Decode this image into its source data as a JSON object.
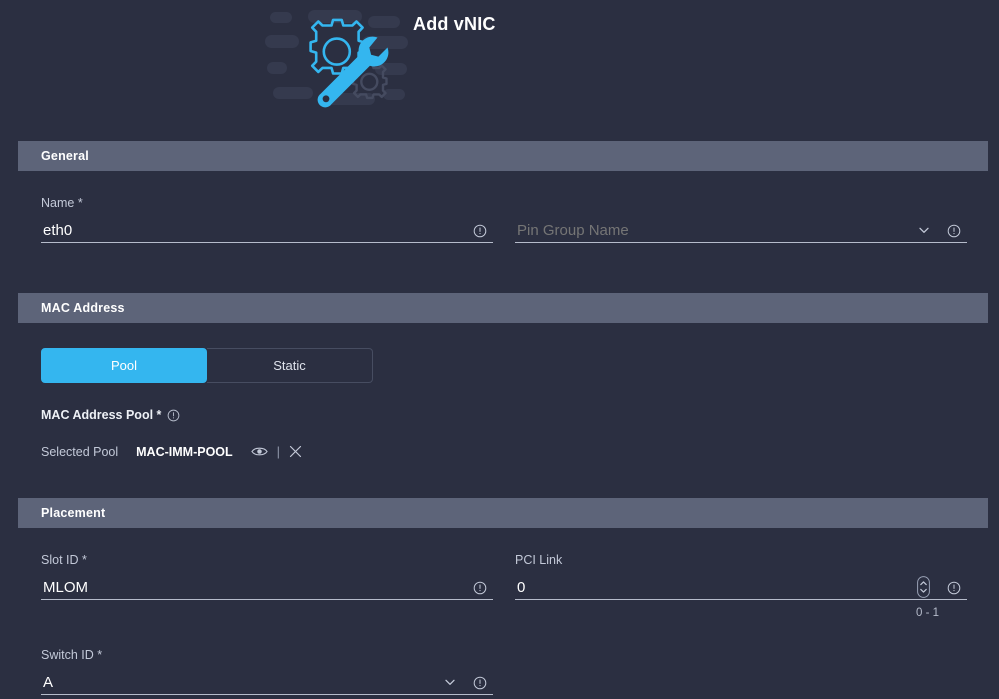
{
  "header": {
    "title": "Add vNIC",
    "illustration_icon": "gear-wrench-illustration"
  },
  "sections": {
    "general": {
      "title": "General",
      "name_field": {
        "label": "Name *",
        "value": "eth0",
        "info_icon": "info-icon"
      },
      "pin_group_field": {
        "label": "",
        "placeholder": "Pin Group Name",
        "value": "",
        "chevron_icon": "chevron-down-icon",
        "info_icon": "info-icon"
      }
    },
    "mac_address": {
      "title": "MAC Address",
      "toggle": {
        "options": [
          "Pool",
          "Static"
        ],
        "selected": "Pool"
      },
      "pool_label": "MAC Address Pool *",
      "pool_info_icon": "info-icon",
      "selected_pool_label": "Selected Pool",
      "selected_pool_value": "MAC-IMM-POOL",
      "view_icon": "eye-icon",
      "divider": "|",
      "clear_icon": "close-icon"
    },
    "placement": {
      "title": "Placement",
      "slot_id_field": {
        "label": "Slot ID *",
        "value": "MLOM",
        "info_icon": "info-icon"
      },
      "pci_link_field": {
        "label": "PCI Link",
        "value": "0",
        "hint": "0 - 1",
        "stepper_icon": "number-stepper-icon",
        "info_icon": "info-icon"
      },
      "switch_id_field": {
        "label": "Switch ID *",
        "value": "A",
        "chevron_icon": "chevron-down-icon",
        "info_icon": "info-icon"
      }
    }
  },
  "colors": {
    "background": "#2b2f41",
    "section_bar": "#5d6479",
    "accent": "#34b6ef",
    "text_primary": "#ffffff",
    "text_secondary": "#c3c9d8",
    "underline": "#b6bccb"
  }
}
